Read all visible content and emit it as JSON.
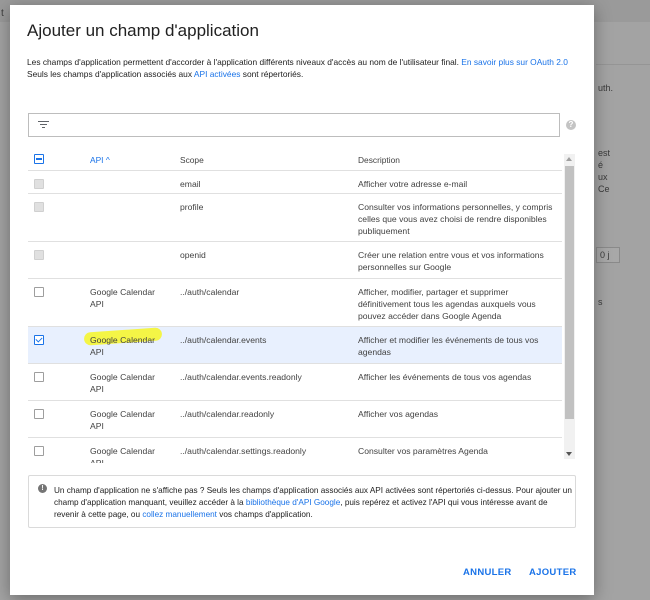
{
  "background": {
    "left_fragment": "t",
    "right_fragments": [
      "uth.",
      "est",
      "é",
      "ux",
      "Ce",
      "0 j",
      "s"
    ]
  },
  "dialog": {
    "title": "Ajouter un champ d'application",
    "description": {
      "line1_before": "Les champs d'application permettent d'accorder à l'application différents niveaux d'accès au nom de l'utilisateur final.",
      "learn_more_link": "En savoir plus sur OAuth 2.0",
      "line2_before": "Seuls les champs d'application associés aux",
      "enabled_apis_link": "API activées",
      "line2_after": "sont répertoriés."
    },
    "filter": {
      "icon": "filter-icon",
      "value": ""
    },
    "help_icon_glyph": "?",
    "table": {
      "headers": {
        "api": "API",
        "api_sort_glyph": "^",
        "scope": "Scope",
        "description": "Description"
      },
      "rows": [
        {
          "api": "",
          "scope": "email",
          "description": "Afficher votre adresse e-mail",
          "checkbox": "disabled"
        },
        {
          "api": "",
          "scope": "profile",
          "description": "Consulter vos informations personnelles, y compris celles que vous avez choisi de rendre disponibles publiquement",
          "checkbox": "disabled"
        },
        {
          "api": "",
          "scope": "openid",
          "description": "Créer une relation entre vous et vos informations personnelles sur Google",
          "checkbox": "disabled"
        },
        {
          "api": "Google Calendar API",
          "scope": "../auth/calendar",
          "description": "Afficher, modifier, partager et supprimer définitivement tous les agendas auxquels vous pouvez accéder dans Google Agenda",
          "checkbox": "unchecked"
        },
        {
          "api": "Google Calendar API",
          "scope": "../auth/calendar.events",
          "description": "Afficher et modifier les événements de tous vos agendas",
          "checkbox": "checked"
        },
        {
          "api": "Google Calendar API",
          "scope": "../auth/calendar.events.readonly",
          "description": "Afficher les événements de tous vos agendas",
          "checkbox": "unchecked"
        },
        {
          "api": "Google Calendar API",
          "scope": "../auth/calendar.readonly",
          "description": "Afficher vos agendas",
          "checkbox": "unchecked"
        },
        {
          "api": "Google Calendar API",
          "scope": "../auth/calendar.settings.readonly",
          "description": "Consulter vos paramètres Agenda",
          "checkbox": "unchecked"
        }
      ]
    },
    "info": {
      "icon_glyph": "!",
      "text_part1": "Un champ d'application ne s'affiche pas ? Seuls les champs d'application associés aux API activées sont répertoriés ci-dessus. Pour ajouter un champ d'application manquant, veuillez accéder à la",
      "library_link": "bibliothèque d'API Google",
      "text_part2": ", puis repérez et activez l'API qui vous intéresse avant de revenir à cette page, ou",
      "manual_link": "collez manuellement",
      "text_part3": "vos champs d'application."
    },
    "buttons": {
      "cancel": "ANNULER",
      "add": "AJOUTER"
    }
  },
  "colors": {
    "accent": "#1a73e8",
    "highlight": "#f4f43c",
    "selected_row": "#e8f0fe"
  }
}
